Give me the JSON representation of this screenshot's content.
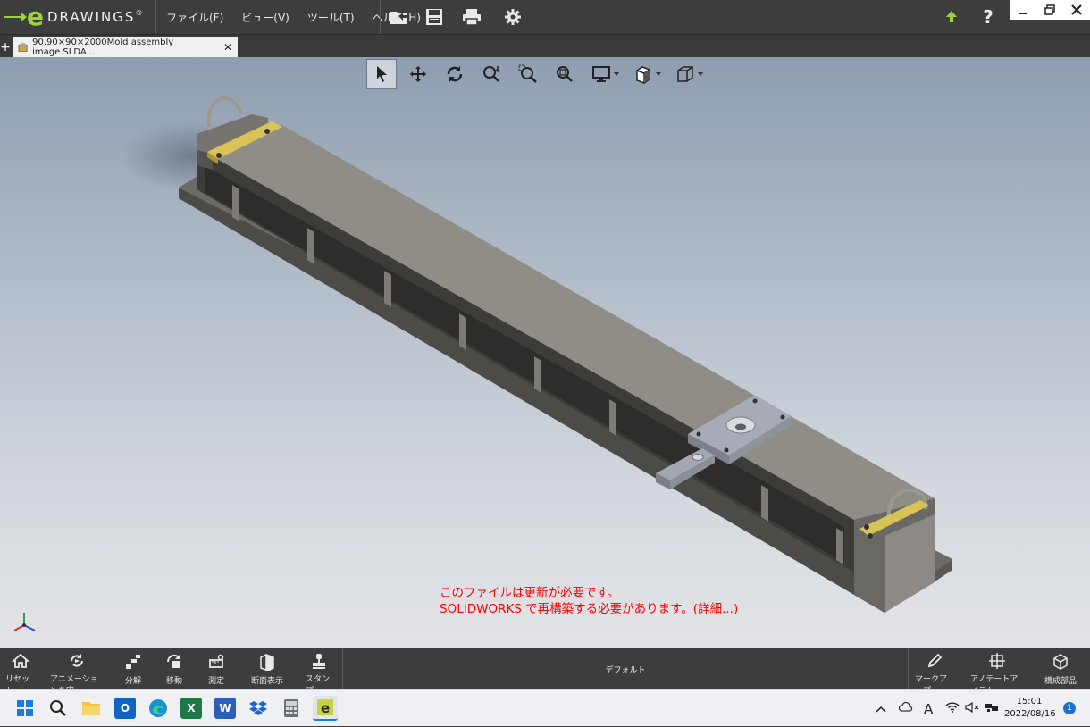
{
  "app": {
    "logo_letter": "e",
    "logo_word": "DRAWINGS",
    "logo_mark": "®",
    "menu": [
      "ファイル(F)",
      "ビュー(V)",
      "ツール(T)",
      "ヘルプ(H)"
    ],
    "toolbar_icons": [
      "open-folder-icon",
      "save-icon",
      "print-icon",
      "settings-gear-icon"
    ],
    "right_icons": [
      "upgrade-arrow-icon",
      "help-icon"
    ],
    "window_buttons": [
      "minimize",
      "restore",
      "close"
    ]
  },
  "tab": {
    "add_label": "+",
    "title": "90.90×90×2000Mold assembly image.SLDA...",
    "close_label": "✕"
  },
  "view_toolbar": [
    "select-arrow-icon",
    "pan-icon",
    "rotate-icon",
    "zoom-icon",
    "zoom-area-icon",
    "zoom-fit-icon",
    "display-style-icon",
    "section-view-icon",
    "standard-views-icon"
  ],
  "warning": {
    "line1": "このファイルは更新が必要です。",
    "line2": "SOLIDWORKS で再構築する必要があります。(詳細...)"
  },
  "bottom_toolbar": {
    "left": [
      {
        "label": "リセット",
        "icon": "home-icon"
      },
      {
        "label": "アニメーションを実",
        "icon": "animate-icon"
      },
      {
        "label": "分解",
        "icon": "explode-icon"
      },
      {
        "label": "移動",
        "icon": "move-icon"
      },
      {
        "label": "測定",
        "icon": "measure-icon"
      },
      {
        "label": "断面表示",
        "icon": "section-icon"
      },
      {
        "label": "スタンプ",
        "icon": "stamp-icon"
      }
    ],
    "configuration": "デフォルト",
    "right": [
      {
        "label": "マークアップ",
        "icon": "pencil-icon"
      },
      {
        "label": "アノテートアイテム",
        "icon": "annotation-icon"
      },
      {
        "label": "構成部品",
        "icon": "components-icon"
      }
    ]
  },
  "taskbar": {
    "apps": [
      "windows-start-icon",
      "search-icon",
      "file-explorer-icon",
      "outlook-icon",
      "edge-icon",
      "excel-icon",
      "word-icon",
      "dropbox-icon",
      "calculator-icon",
      "edrawings-icon"
    ],
    "tray_font_indicator": "A",
    "time": "15:01",
    "date": "2022/08/16",
    "notifications": "1"
  },
  "colors": {
    "accent_green": "#9ad23a",
    "warning_red": "#ff0000",
    "bar_dark": "#3d3d3d"
  }
}
